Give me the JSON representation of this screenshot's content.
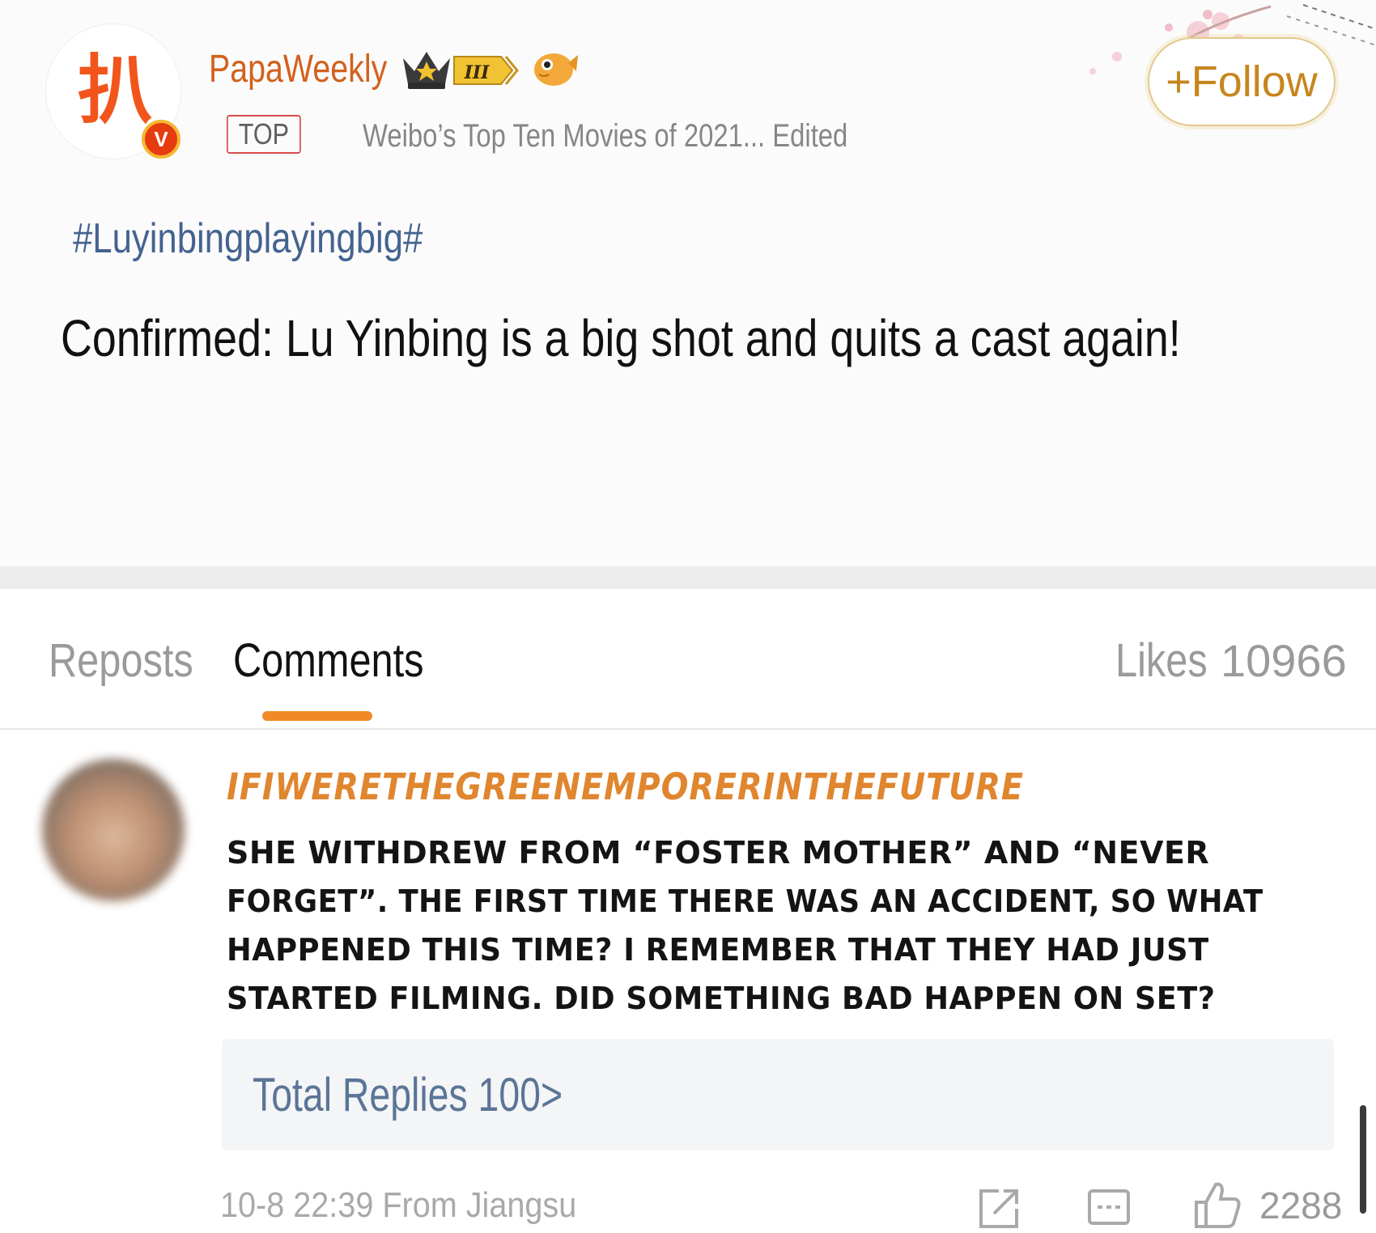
{
  "post": {
    "username": "PapaWeekly",
    "avatar_glyph": "扒",
    "verified_mark": "V",
    "level_badge": "III",
    "top_tag": "TOP",
    "meta": "Weibo’s Top Ten Movies of 2021... Edited",
    "follow_label": "+Follow",
    "hashtag": "#Luyinbingplayingbig#",
    "text": "Confirmed: Lu Yinbing is a big shot and quits a cast again!"
  },
  "tabs": {
    "reposts": "Reposts",
    "comments": "Comments",
    "likes_label": "Likes",
    "likes_count": "10966"
  },
  "comment": {
    "username": "IFIWERETHEGREENEMPORERINTHEFUTURE",
    "lines": [
      "SHE WITHDREW FROM “FOSTER MOTHER” AND “NEVER",
      "FORGET”. THE FIRST TIME THERE WAS AN ACCIDENT, SO WHAT",
      "HAPPENED THIS TIME? I REMEMBER THAT THEY HAD JUST",
      "STARTED FILMING. DID SOMETHING BAD HAPPEN ON SET?"
    ],
    "replies": "Total Replies 100>",
    "time_location": "10-8 22:39  From Jiangsu",
    "like_count": "2288"
  },
  "icons": {
    "crown": "crown-badge-icon",
    "fish": "pufferfish-badge-icon",
    "share": "share-icon",
    "comment": "comment-icon",
    "like": "thumbs-up-icon"
  },
  "colors": {
    "username": "#d2611c",
    "follow": "#c6861d",
    "hashtag": "#44638f",
    "tab_underline": "#f08a27",
    "comment_user": "#e0862f",
    "replies": "#5b7596",
    "verified": "#e53b0f"
  }
}
